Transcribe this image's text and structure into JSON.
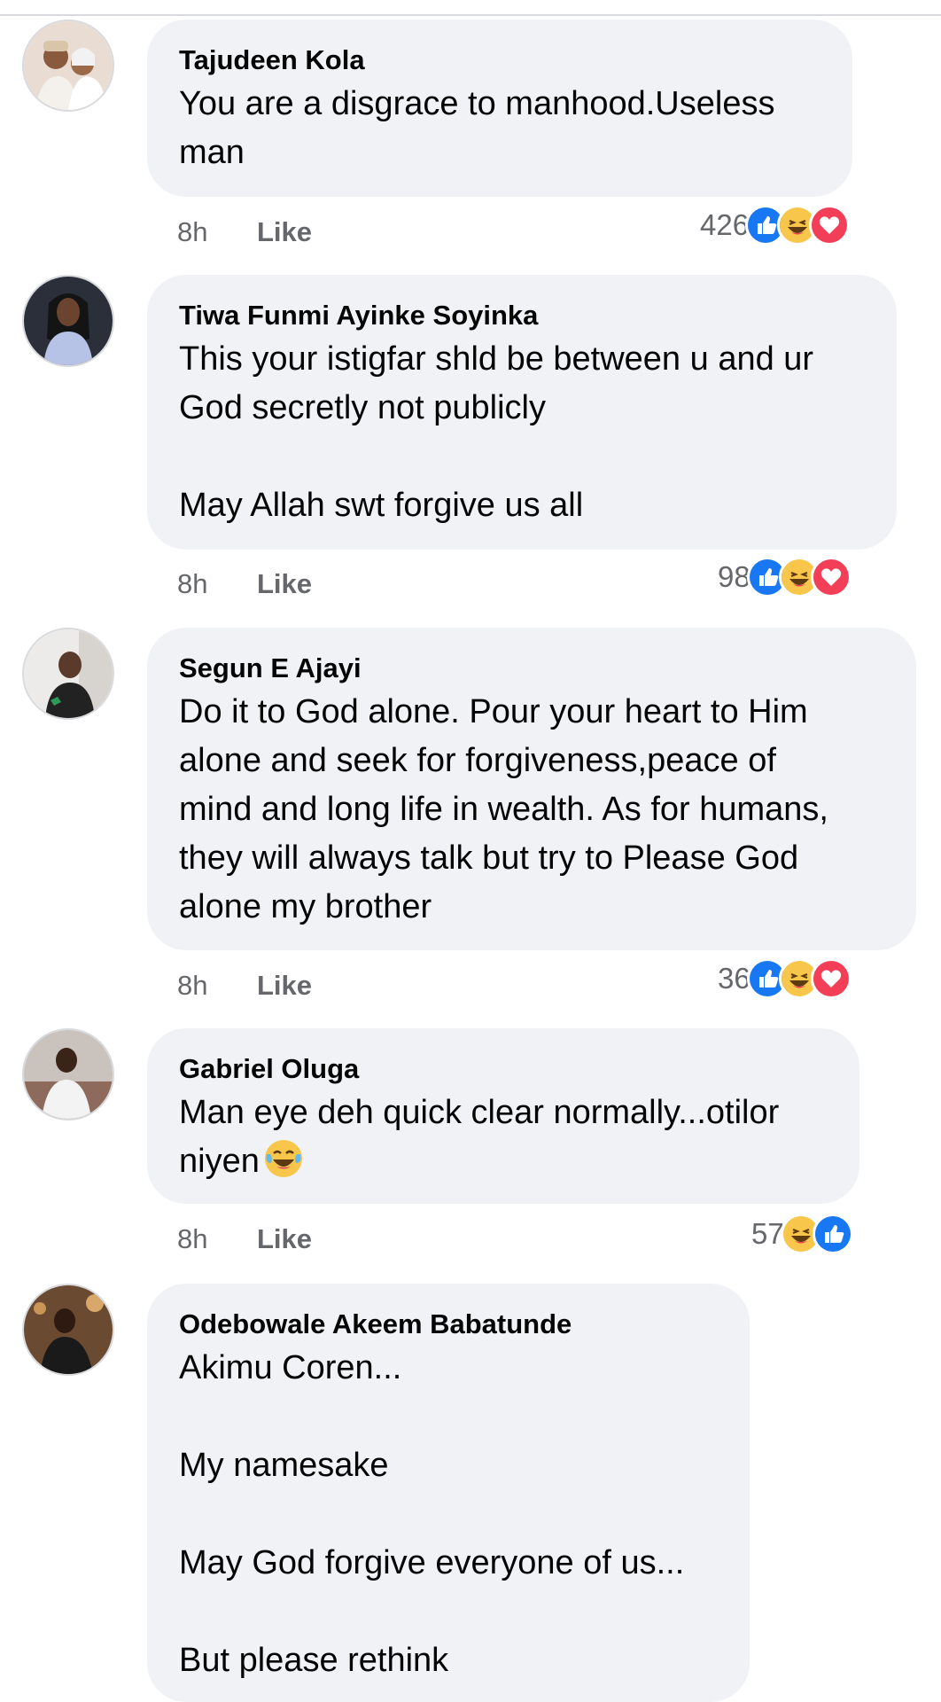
{
  "colors": {
    "bubble_bg": "#f0f2f5",
    "meta_text": "#65676b",
    "like_blue": "#1877f2",
    "haha_yellow": "#f7c64b",
    "love_red": "#f33e58"
  },
  "comments": [
    {
      "author": "Tajudeen Kola",
      "text": "You are a disgrace to manhood.Useless\nman",
      "time": "8h",
      "like_label": "Like",
      "reaction_count": "426",
      "reactions": [
        "like-icon",
        "haha-icon",
        "love-icon"
      ]
    },
    {
      "author": "Tiwa Funmi Ayinke Soyinka",
      "text": "This your istigfar shld be between u and ur\nGod secretly not publicly\n\nMay Allah swt forgive us all",
      "time": "8h",
      "like_label": "Like",
      "reaction_count": "98",
      "reactions": [
        "like-icon",
        "haha-icon",
        "love-icon"
      ]
    },
    {
      "author": "Segun E Ajayi",
      "text": "Do it to God alone. Pour your heart to Him\nalone and seek for forgiveness,peace of\nmind and long life in wealth. As for humans,\nthey will always talk but try to Please God\nalone my brother",
      "time": "8h",
      "like_label": "Like",
      "reaction_count": "36",
      "reactions": [
        "like-icon",
        "haha-icon",
        "love-icon"
      ]
    },
    {
      "author": "Gabriel Oluga",
      "text_line1": "Man eye deh quick clear normally...otilor",
      "text_line2": "niyen",
      "inline_emoji": "laughing-tears-emoji",
      "time": "8h",
      "like_label": "Like",
      "reaction_count": "57",
      "reactions": [
        "haha-icon",
        "like-icon"
      ]
    },
    {
      "author": "Odebowale Akeem Babatunde",
      "text": "Akimu Coren...\n\nMy namesake\n\nMay God forgive everyone of us...\n\nBut please rethink"
    }
  ]
}
